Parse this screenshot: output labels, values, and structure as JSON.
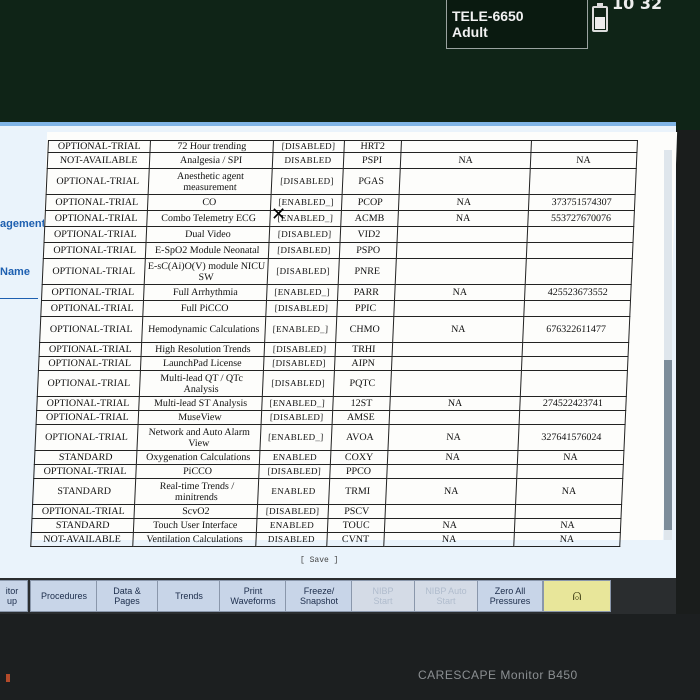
{
  "header": {
    "patient_id": "TELE-6650",
    "patient_type": "Adult",
    "time_fragment": "10 32"
  },
  "side_panel": {
    "management_label": "agement",
    "name_label": "Name"
  },
  "table": {
    "rows": [
      [
        "OPTIONAL-TRIAL",
        "72 Hour trending",
        "[DISABLED]",
        "HRT2",
        "",
        ""
      ],
      [
        "NOT-AVAILABLE",
        "Analgesia / SPI",
        "DISABLED",
        "PSPI",
        "NA",
        "NA"
      ],
      [
        "OPTIONAL-TRIAL",
        "Anesthetic agent measurement",
        "[DISABLED]",
        "PGAS",
        "",
        ""
      ],
      [
        "OPTIONAL-TRIAL",
        "CO",
        "[ENABLED_]",
        "PCOP",
        "NA",
        "373751574307"
      ],
      [
        "OPTIONAL-TRIAL",
        "Combo Telemetry ECG",
        "[ENABLED_]",
        "ACMB",
        "NA",
        "553727670076"
      ],
      [
        "OPTIONAL-TRIAL",
        "Dual Video",
        "[DISABLED]",
        "VID2",
        "",
        ""
      ],
      [
        "OPTIONAL-TRIAL",
        "E-SpO2 Module Neonatal",
        "[DISABLED]",
        "PSPO",
        "",
        ""
      ],
      [
        "OPTIONAL-TRIAL",
        "E-sC(Ai)O(V) module NICU SW",
        "[DISABLED]",
        "PNRE",
        "",
        ""
      ],
      [
        "OPTIONAL-TRIAL",
        "Full Arrhythmia",
        "[ENABLED_]",
        "PARR",
        "NA",
        "425523673552"
      ],
      [
        "OPTIONAL-TRIAL",
        "Full PiCCO",
        "[DISABLED]",
        "PPIC",
        "",
        ""
      ],
      [
        "OPTIONAL-TRIAL",
        "Hemodynamic Calculations",
        "[ENABLED_]",
        "CHMO",
        "NA",
        "676322611477"
      ],
      [
        "OPTIONAL-TRIAL",
        "High Resolution Trends",
        "[DISABLED]",
        "TRHI",
        "",
        ""
      ],
      [
        "OPTIONAL-TRIAL",
        "LaunchPad License",
        "[DISABLED]",
        "AIPN",
        "",
        ""
      ],
      [
        "OPTIONAL-TRIAL",
        "Multi-lead QT / QTc Analysis",
        "[DISABLED]",
        "PQTC",
        "",
        ""
      ],
      [
        "OPTIONAL-TRIAL",
        "Multi-lead ST Analysis",
        "[ENABLED_]",
        "12ST",
        "NA",
        "274522423741"
      ],
      [
        "OPTIONAL-TRIAL",
        "MuseView",
        "[DISABLED]",
        "AMSE",
        "",
        ""
      ],
      [
        "OPTIONAL-TRIAL",
        "Network and Auto Alarm View",
        "[ENABLED_]",
        "AVOA",
        "NA",
        "327641576024"
      ],
      [
        "STANDARD",
        "Oxygenation Calculations",
        "ENABLED",
        "COXY",
        "NA",
        "NA"
      ],
      [
        "OPTIONAL-TRIAL",
        "PiCCO",
        "[DISABLED]",
        "PPCO",
        "",
        ""
      ],
      [
        "STANDARD",
        "Real-time Trends / minitrends",
        "ENABLED",
        "TRMI",
        "NA",
        "NA"
      ],
      [
        "OPTIONAL-TRIAL",
        "ScvO2",
        "[DISABLED]",
        "PSCV",
        "",
        ""
      ],
      [
        "STANDARD",
        "Touch User Interface",
        "ENABLED",
        "TOUC",
        "NA",
        "NA"
      ],
      [
        "NOT-AVAILABLE",
        "Ventilation Calculations",
        "DISABLED",
        "CVNT",
        "NA",
        "NA"
      ]
    ]
  },
  "save_label": "[ Save ]",
  "buttons": {
    "monitor_setup": "itor\nup",
    "procedures": "Procedures",
    "data_pages": "Data &\nPages",
    "trends": "Trends",
    "print_waveforms": "Print\nWaveforms",
    "freeze_snapshot": "Freeze/\nSnapshot",
    "nibp_start": "NIBP\nStart",
    "nibp_auto": "NIBP Auto\nStart",
    "zero_all_pressures": "Zero All\nPressures",
    "alarm_icon": "alarm-bell"
  },
  "brand": "CARESCAPE Monitor B450"
}
